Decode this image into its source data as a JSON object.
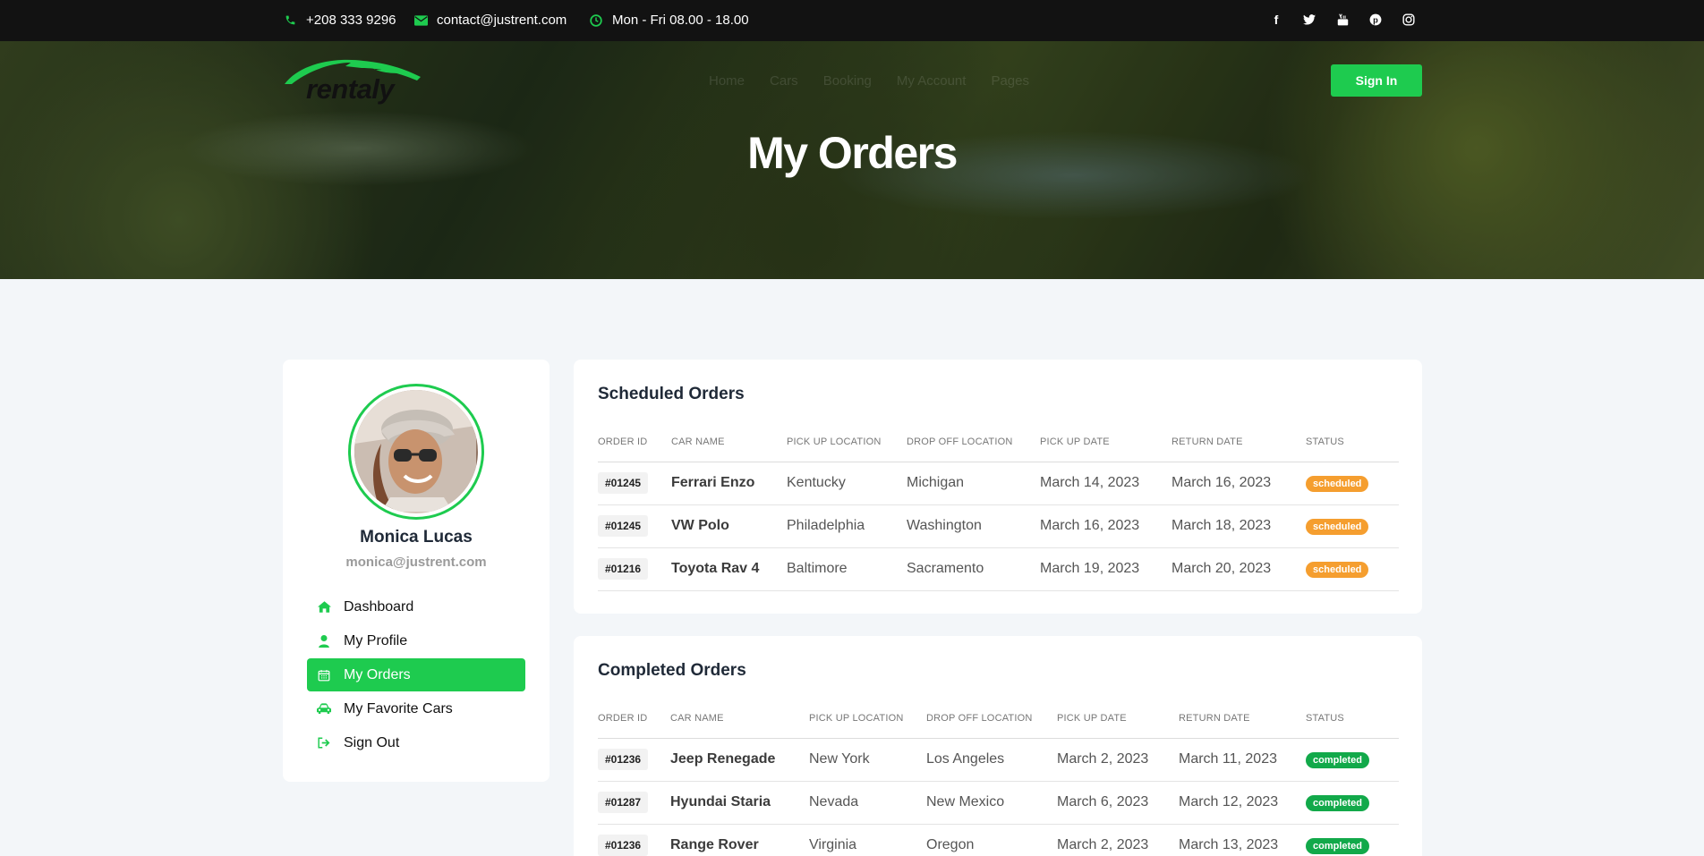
{
  "topbar": {
    "phone": "+208 333 9296",
    "email": "contact@justrent.com",
    "hours": "Mon - Fri 08.00 - 18.00",
    "social": [
      "facebook-icon",
      "twitter-icon",
      "youtube-icon",
      "pinterest-icon",
      "instagram-icon"
    ]
  },
  "header": {
    "logo_text": "rentaly",
    "nav": [
      "Home",
      "Cars",
      "Booking",
      "My Account",
      "Pages"
    ],
    "signin_label": "Sign In",
    "page_title": "My Orders"
  },
  "profile": {
    "name": "Monica Lucas",
    "email": "monica@justrent.com"
  },
  "menu": [
    {
      "label": "Dashboard",
      "icon": "home-icon",
      "active": false
    },
    {
      "label": "My Profile",
      "icon": "user-icon",
      "active": false
    },
    {
      "label": "My Orders",
      "icon": "calendar-icon",
      "active": true
    },
    {
      "label": "My Favorite Cars",
      "icon": "car-icon",
      "active": false
    },
    {
      "label": "Sign Out",
      "icon": "sign-out-icon",
      "active": false
    }
  ],
  "scheduled": {
    "title": "Scheduled Orders",
    "columns": [
      "Order ID",
      "Car Name",
      "Pick Up Location",
      "Drop Off Location",
      "Pick Up Date",
      "Return Date",
      "Status"
    ],
    "rows": [
      {
        "id": "#01245",
        "car": "Ferrari Enzo",
        "pickup": "Kentucky",
        "dropoff": "Michigan",
        "pickup_date": "March 14, 2023",
        "return_date": "March 16, 2023",
        "status": "scheduled"
      },
      {
        "id": "#01245",
        "car": "VW Polo",
        "pickup": "Philadelphia",
        "dropoff": "Washington",
        "pickup_date": "March 16, 2023",
        "return_date": "March 18, 2023",
        "status": "scheduled"
      },
      {
        "id": "#01216",
        "car": "Toyota Rav 4",
        "pickup": "Baltimore",
        "dropoff": "Sacramento",
        "pickup_date": "March 19, 2023",
        "return_date": "March 20, 2023",
        "status": "scheduled"
      }
    ]
  },
  "completed": {
    "title": "Completed Orders",
    "columns": [
      "Order ID",
      "Car Name",
      "Pick Up Location",
      "Drop Off Location",
      "Pick Up Date",
      "Return Date",
      "Status"
    ],
    "rows": [
      {
        "id": "#01236",
        "car": "Jeep Renegade",
        "pickup": "New York",
        "dropoff": "Los Angeles",
        "pickup_date": "March 2, 2023",
        "return_date": "March 11, 2023",
        "status": "completed"
      },
      {
        "id": "#01287",
        "car": "Hyundai Staria",
        "pickup": "Nevada",
        "dropoff": "New Mexico",
        "pickup_date": "March 6, 2023",
        "return_date": "March 12, 2023",
        "status": "completed"
      },
      {
        "id": "#01236",
        "car": "Range Rover",
        "pickup": "Virginia",
        "dropoff": "Oregon",
        "pickup_date": "March 2, 2023",
        "return_date": "March 13, 2023",
        "status": "completed"
      }
    ]
  },
  "colors": {
    "accent": "#1ecb4f",
    "scheduled_badge": "#f59e2f",
    "completed_badge": "#12a94a"
  }
}
